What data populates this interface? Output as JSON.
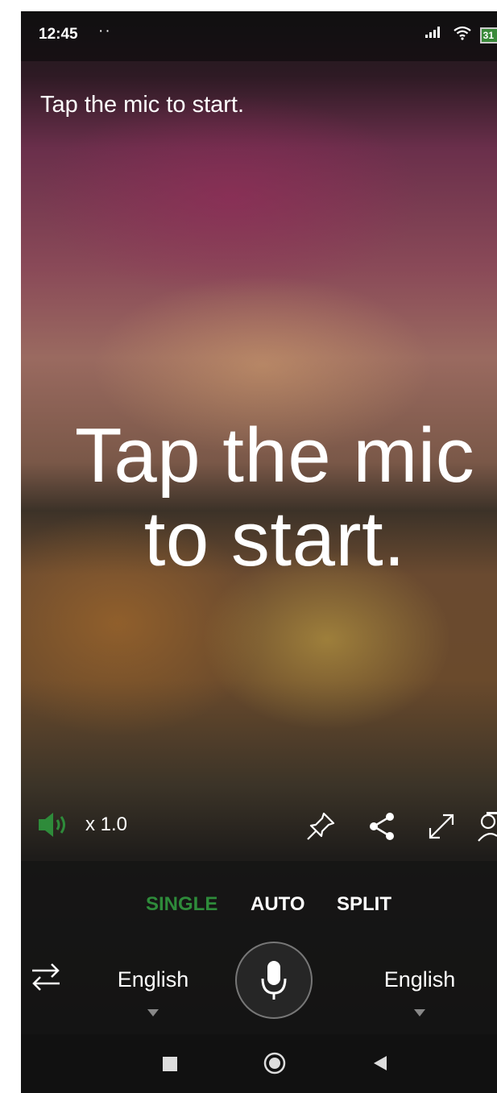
{
  "status_bar": {
    "time": "12:45",
    "dots": "··",
    "battery": "31"
  },
  "prompt": {
    "small": "Tap the mic to start.",
    "big_line1": "Tap the mic",
    "big_line2": "to start."
  },
  "controls": {
    "speed": "x 1.0",
    "icons": [
      "speaker-icon",
      "pin-icon",
      "share-icon",
      "expand-icon",
      "person-icon"
    ]
  },
  "modes": {
    "items": [
      "SINGLE",
      "AUTO",
      "SPLIT"
    ],
    "active": "SINGLE",
    "active_color": "#2e8b3a"
  },
  "languages": {
    "source": "English",
    "target": "English"
  },
  "nav": {
    "icons": [
      "recents-icon",
      "home-icon",
      "back-icon"
    ]
  }
}
